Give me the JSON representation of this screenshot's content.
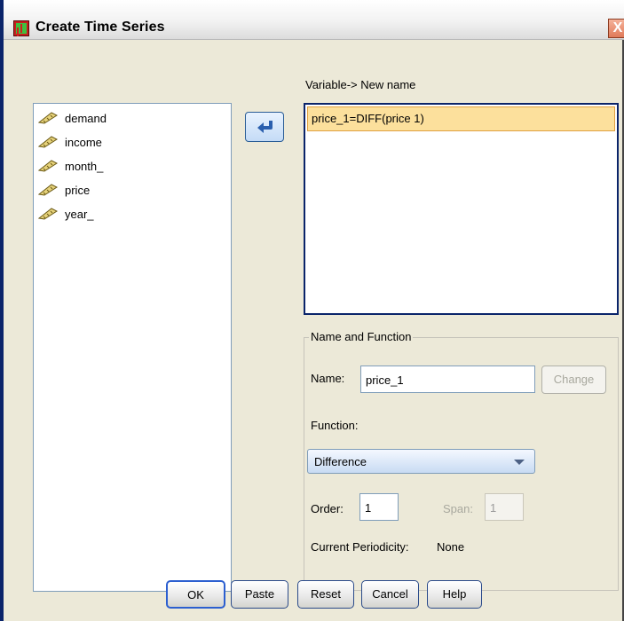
{
  "window": {
    "title": "Create Time Series",
    "close_glyph": "X"
  },
  "mapping": {
    "header_label": "Variable-> New name",
    "items": [
      "price_1=DIFF(price 1)"
    ]
  },
  "variables": {
    "items": [
      "demand",
      "income",
      "month_",
      "price",
      "year_"
    ],
    "icon": "ruler-scale-icon"
  },
  "move_button": {
    "icon": "arrow-left-icon"
  },
  "name_and_function": {
    "legend": "Name and Function",
    "name_label": "Name:",
    "name_value": "price_1",
    "change_label": "Change",
    "function_label": "Function:",
    "function_value": "Difference",
    "order_label": "Order:",
    "order_value": "1",
    "span_label": "Span:",
    "span_value": "1",
    "periodicity_label": "Current Periodicity:",
    "periodicity_value": "None"
  },
  "buttons": {
    "ok": "OK",
    "paste": "Paste",
    "reset": "Reset",
    "cancel": "Cancel",
    "help": "Help"
  },
  "colors": {
    "title_text": "#000000",
    "selection_fill": "#fce09c",
    "focus_border": "#0a246a"
  }
}
